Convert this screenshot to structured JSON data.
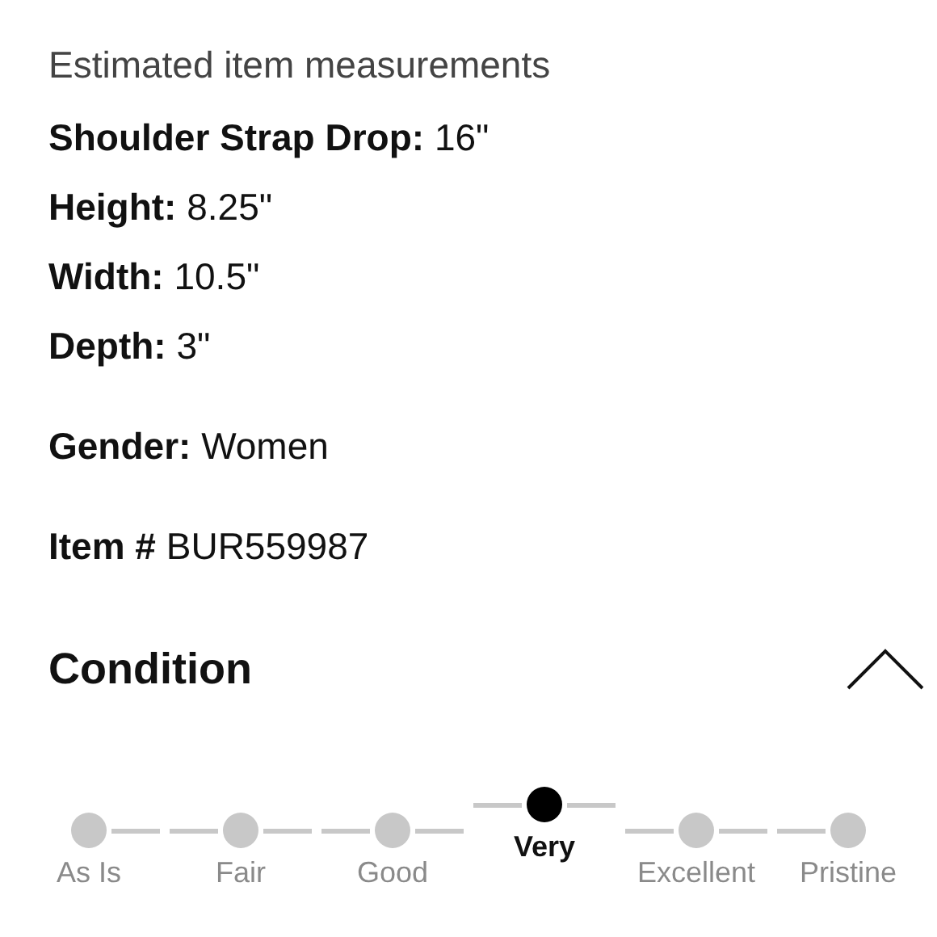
{
  "section_title": "Estimated item measurements",
  "measurements": [
    {
      "label": "Shoulder Strap Drop:",
      "value": "16\""
    },
    {
      "label": "Height:",
      "value": "8.25\""
    },
    {
      "label": "Width:",
      "value": "10.5\""
    },
    {
      "label": "Depth:",
      "value": "3\""
    }
  ],
  "gender": {
    "label": "Gender:",
    "value": "Women"
  },
  "item_number": {
    "label": "Item #",
    "value": "BUR559987"
  },
  "condition": {
    "title": "Condition",
    "expanded": true,
    "steps": [
      {
        "label": "As Is",
        "selected": false
      },
      {
        "label": "Fair",
        "selected": false
      },
      {
        "label": "Good",
        "selected": false
      },
      {
        "label": "Very",
        "selected": true
      },
      {
        "label": "Excellent",
        "selected": false
      },
      {
        "label": "Pristine",
        "selected": false
      }
    ]
  }
}
